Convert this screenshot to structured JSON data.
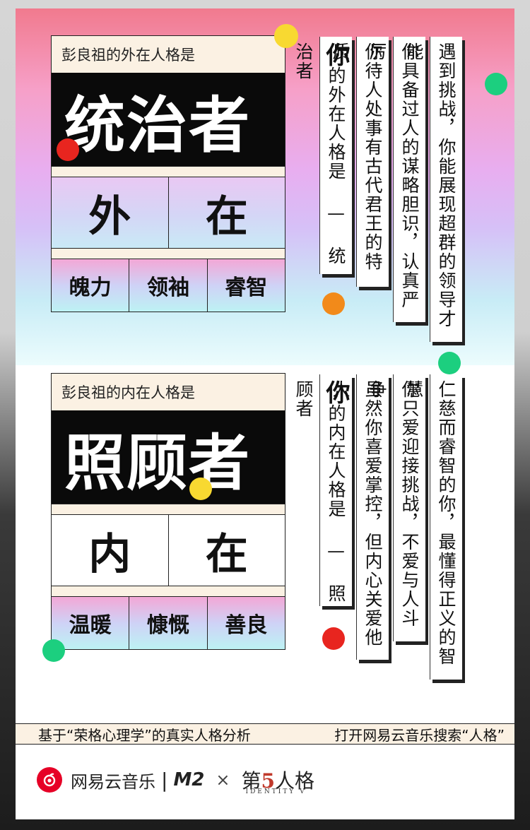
{
  "outer": {
    "label": "彭良祖的外在人格是",
    "title": "统治者",
    "big": [
      "外",
      "在"
    ],
    "traits": [
      "魄力",
      "领袖",
      "睿智"
    ],
    "columns": [
      {
        "lead": "你",
        "text": "的外在人格是 — 统治者"
      },
      {
        "text": "你待人处事有古代君王的特质"
      },
      {
        "text": "你具备过人的谋略胆识，认真严厉"
      },
      {
        "text": "遇到挑战，你能展现超群的领导才能"
      }
    ]
  },
  "inner": {
    "label": "彭良祖的内在人格是",
    "title": "照顾者",
    "big": [
      "内",
      "在"
    ],
    "traits": [
      "温暖",
      "慷慨",
      "善良"
    ],
    "columns": [
      {
        "lead": "你",
        "text": "的内在人格是 — 照顾者"
      },
      {
        "text": "虽然你喜爱掌控，但内心关爱他人"
      },
      {
        "text": "你只爱迎接挑战，不爱与人斗争"
      },
      {
        "text": "仁慈而睿智的你，最懂得正义的智慧"
      }
    ]
  },
  "footer": {
    "left": "基于“荣格心理学”的真实人格分析",
    "right": "打开网易云音乐搜索“人格”"
  },
  "brand": {
    "name": "网易云音乐",
    "divider": "|",
    "m2": "M2",
    "times": "×",
    "game_pre": "第",
    "game_num": "5",
    "game_post": "人格",
    "game_sub": "IDENTITY V"
  },
  "colors": {
    "yellow": "#f8d931",
    "red": "#e8251f",
    "green": "#1ccf7f",
    "orange": "#f28a1a",
    "brand_red": "#e60026"
  }
}
